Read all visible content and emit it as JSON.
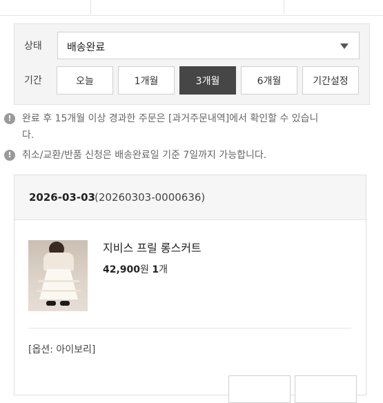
{
  "filter": {
    "status_label": "상태",
    "status_value": "배송완료",
    "period_label": "기간",
    "periods": [
      {
        "label": "오늘",
        "active": false
      },
      {
        "label": "1개월",
        "active": false
      },
      {
        "label": "3개월",
        "active": true
      },
      {
        "label": "6개월",
        "active": false
      },
      {
        "label": "기간설정",
        "active": false
      }
    ]
  },
  "notices": [
    {
      "icon": "info-icon",
      "line1": "완료 후 15개월 이상 경과한 주문은 [과거주문내역]에서 확인할 수 있습니",
      "line2": "다."
    },
    {
      "icon": "info-icon",
      "line1": "취소/교환/반품 신청은 배송완료일 기준 7일까지 가능합니다."
    }
  ],
  "order": {
    "date": "2026-03-03",
    "number": "(20260303-0000636)",
    "product_name": "지비스 프릴 롱스커트",
    "price": "42,900",
    "price_unit": "원",
    "quantity": "1",
    "quantity_unit": "개",
    "option": "[옵션: 아이보리]"
  },
  "colors": {
    "active_period_bg": "#464646",
    "panel_bg": "#f4f4f4",
    "info_icon": "#9a9a9a"
  }
}
